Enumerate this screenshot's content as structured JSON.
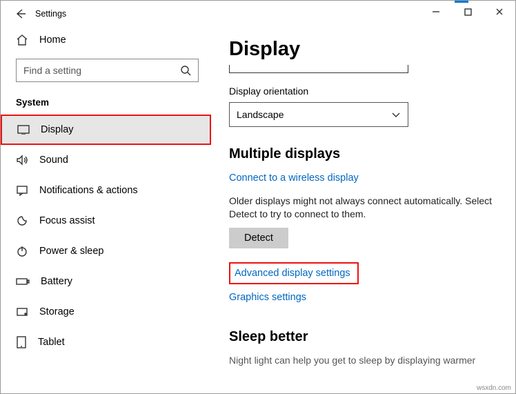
{
  "titlebar": {
    "title": "Settings"
  },
  "sidebar": {
    "home": "Home",
    "search_placeholder": "Find a setting",
    "section": "System",
    "items": [
      {
        "icon": "display",
        "label": "Display",
        "selected": true,
        "boxed": true
      },
      {
        "icon": "sound",
        "label": "Sound"
      },
      {
        "icon": "notifications",
        "label": "Notifications & actions"
      },
      {
        "icon": "focus",
        "label": "Focus assist"
      },
      {
        "icon": "power",
        "label": "Power & sleep"
      },
      {
        "icon": "battery",
        "label": "Battery"
      },
      {
        "icon": "storage",
        "label": "Storage"
      },
      {
        "icon": "tablet",
        "label": "Tablet"
      }
    ]
  },
  "main": {
    "heading": "Display",
    "orientation_label": "Display orientation",
    "orientation_value": "Landscape",
    "multi_heading": "Multiple displays",
    "wireless_link": "Connect to a wireless display",
    "detect_desc": "Older displays might not always connect automatically. Select Detect to try to connect to them.",
    "detect_btn": "Detect",
    "advanced_link": "Advanced display settings",
    "graphics_link": "Graphics settings",
    "sleep_heading": "Sleep better",
    "sleep_desc": "Night light can help you get to sleep by displaying warmer"
  },
  "watermark": "wsxdn.com"
}
